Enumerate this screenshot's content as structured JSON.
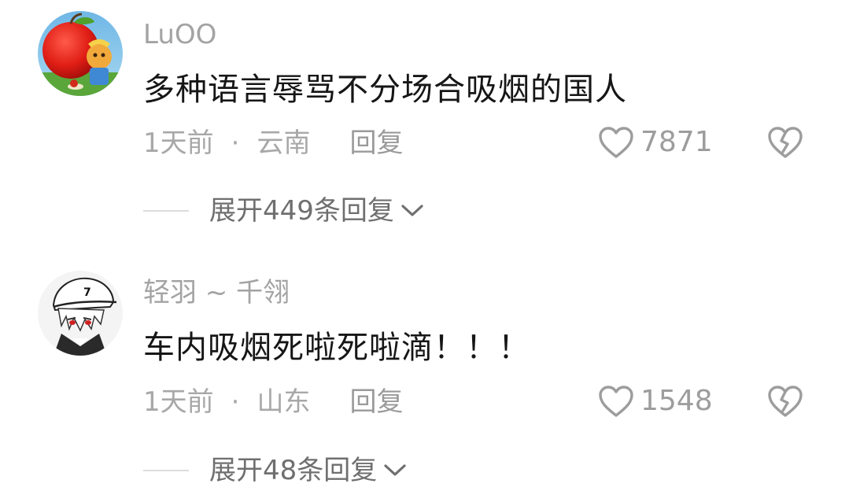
{
  "comments": [
    {
      "username": "LuOO",
      "content": "多种语言辱骂不分场合吸烟的国人",
      "time": "1天前",
      "separator": "·",
      "location": "云南",
      "reply_label": "回复",
      "likes": "7871",
      "expand_label": "展开449条回复",
      "avatar_icon": "apple-cartoon-avatar-icon"
    },
    {
      "username": "轻羽 ~ 千翎",
      "content": "车内吸烟死啦死啦滴！！！",
      "time": "1天前",
      "separator": "·",
      "location": "山东",
      "reply_label": "回复",
      "likes": "1548",
      "expand_label": "展开48条回复",
      "avatar_icon": "anime-boy-cap-avatar-icon"
    }
  ],
  "icons": {
    "like": "heart-outline-icon",
    "dislike": "broken-heart-icon",
    "expand": "chevron-down-icon"
  },
  "colors": {
    "text_primary": "#161616",
    "text_secondary": "#a3a3a3",
    "icon_gray": "#9d9d9d"
  }
}
